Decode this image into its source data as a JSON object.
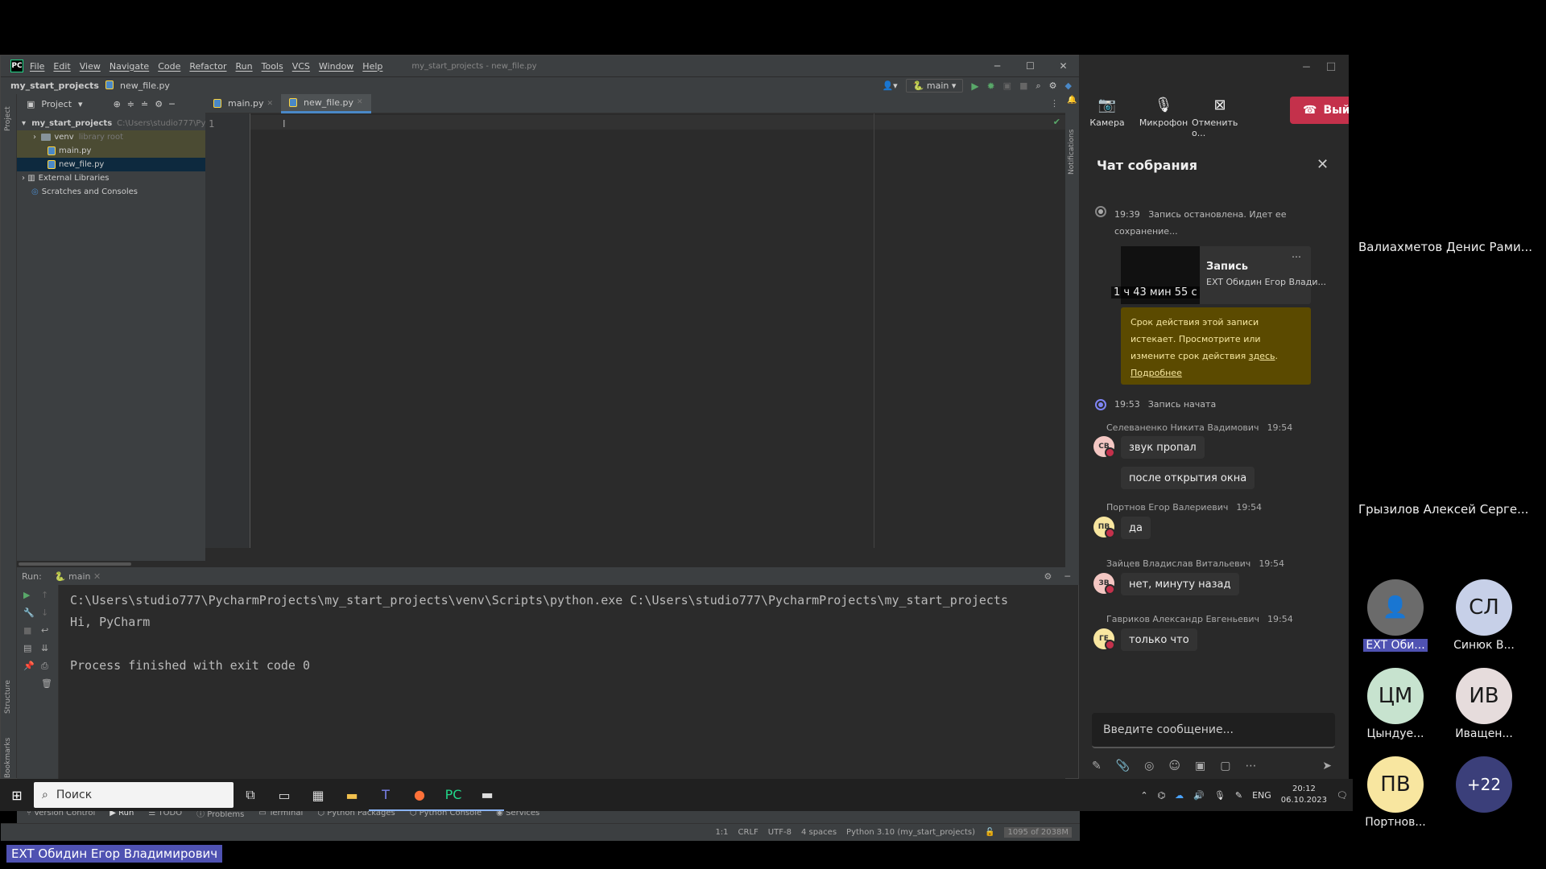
{
  "pycharm": {
    "logo": "PC",
    "menu": [
      "File",
      "Edit",
      "View",
      "Navigate",
      "Code",
      "Refactor",
      "Run",
      "Tools",
      "VCS",
      "Window",
      "Help"
    ],
    "window_title": "my_start_projects - new_file.py",
    "breadcrumb": {
      "project": "my_start_projects",
      "file": "new_file.py"
    },
    "run_config": "main",
    "project_panel_label": "Project",
    "tree": {
      "root": "my_start_projects",
      "root_path": "C:\\Users\\studio777\\Py",
      "venv": "venv",
      "venv_note": "library root",
      "main": "main.py",
      "newfile": "new_file.py",
      "ext_libs": "External Libraries",
      "scratches": "Scratches and Consoles"
    },
    "tabs": [
      {
        "label": "main.py"
      },
      {
        "label": "new_file.py"
      }
    ],
    "editor": {
      "line_number": "1"
    },
    "run_panel": {
      "label": "Run:",
      "tab": "main"
    },
    "console_lines": [
      "C:\\Users\\studio777\\PycharmProjects\\my_start_projects\\venv\\Scripts\\python.exe C:\\Users\\studio777\\PycharmProjects\\my_start_projects",
      "Hi, PyCharm",
      "",
      "Process finished with exit code 0"
    ],
    "bottom_tabs": [
      "Version Control",
      "Run",
      "TODO",
      "Problems",
      "Terminal",
      "Python Packages",
      "Python Console",
      "Services"
    ],
    "status": {
      "position": "1:1",
      "line_sep": "CRLF",
      "encoding": "UTF-8",
      "indent": "4 spaces",
      "interpreter": "Python 3.10 (my_start_projects)",
      "memory": "1095 of 2038M"
    },
    "side_labels": {
      "project": "Project",
      "structure": "Structure",
      "bookmarks": "Bookmarks",
      "notifications": "Notifications"
    }
  },
  "teams": {
    "controls": [
      {
        "label": "Камера",
        "icon": "camera-off-icon"
      },
      {
        "label": "Микрофон",
        "icon": "mic-icon"
      },
      {
        "label": "Отменить о...",
        "icon": "share-stop-icon"
      }
    ],
    "leave_label": "Вый",
    "chat_title": "Чат собрания",
    "events": [
      {
        "time": "19:39",
        "text": "Запись остановлена. Идет ее",
        "text2": "сохранение..."
      },
      {
        "time": "19:53",
        "text": "Запись начата"
      }
    ],
    "recording": {
      "title": "Запись",
      "by": "EXT Обидин Егор Влади...",
      "duration": "1 ч 43 мин 55 с"
    },
    "warning": {
      "line1": "Срок действия этой записи",
      "line2": "истекает. Просмотрите или",
      "line3": "измените срок действия",
      "link": "здесь",
      "more": "Подробнее"
    },
    "messages": [
      {
        "sender": "Селеваненко Никита Вадимович",
        "time": "19:54",
        "initials": "СВ",
        "color": "#f4c7c3",
        "texts": [
          "звук пропал",
          "после открытия окна"
        ]
      },
      {
        "sender": "Портнов Егор Валериевич",
        "time": "19:54",
        "initials": "ПВ",
        "color": "#f8e6a0",
        "texts": [
          "да"
        ]
      },
      {
        "sender": "Зайцев Владислав Витальевич",
        "time": "19:54",
        "initials": "ЗВ",
        "color": "#f4c7c3",
        "texts": [
          "нет, минуту назад"
        ]
      },
      {
        "sender": "Гавриков Александр Евгеньевич",
        "time": "19:54",
        "initials": "ГЕ",
        "color": "#f8e6a0",
        "texts": [
          "только что"
        ]
      }
    ],
    "input_placeholder": "Введите сообщение..."
  },
  "participants": {
    "names": [
      "Валиахметов Денис Рами...",
      "Грызилов Алексей Серге..."
    ],
    "tiles": [
      {
        "initials": "",
        "label": "EXT Оби...",
        "color": "#6b6b6b"
      },
      {
        "initials": "СЛ",
        "label": "Синюк В...",
        "color": "#c7d0e8"
      },
      {
        "initials": "ЦМ",
        "label": "Цындуе...",
        "color": "#c7e3cf"
      },
      {
        "initials": "ИВ",
        "label": "Иващен...",
        "color": "#e6dcdc"
      },
      {
        "initials": "ПВ",
        "label": "Портнов...",
        "color": "#f8e6a0"
      },
      {
        "initials": "+22",
        "label": "",
        "color": "#3b3f7a"
      }
    ]
  },
  "taskbar": {
    "search_placeholder": "Поиск",
    "lang": "ENG",
    "time": "20:12",
    "date": "06.10.2023"
  },
  "speaker_label": "EXT Обидин Егор Владимирович"
}
